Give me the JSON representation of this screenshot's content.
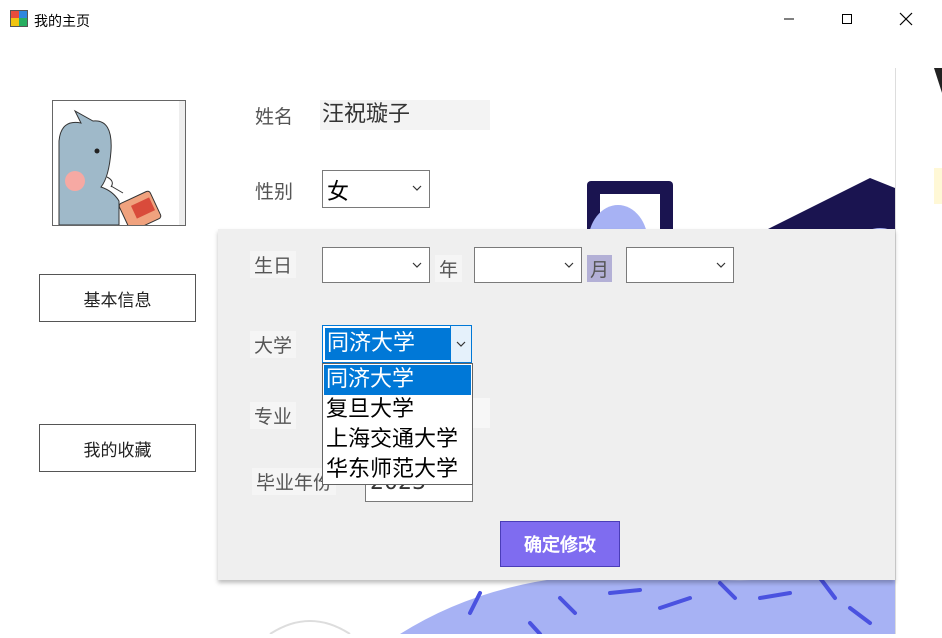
{
  "window": {
    "title": "我的主页"
  },
  "sidebar": {
    "basic_info_label": "基本信息",
    "favorites_label": "我的收藏"
  },
  "profile": {
    "name_label": "姓名",
    "name_value": "汪祝璇子",
    "gender_label": "性别",
    "gender_value": "女"
  },
  "form": {
    "birthday_label": "生日",
    "year_label": "年",
    "month_label": "月",
    "birth_year_value": "",
    "birth_month_value": "",
    "birth_day_value": "",
    "university_label": "大学",
    "university_value": "同济大学",
    "university_options": [
      "同济大学",
      "复旦大学",
      "上海交通大学",
      "华东师范大学"
    ],
    "major_label": "专业",
    "grad_year_label": "毕业年份",
    "grad_year_value": "2023",
    "confirm_label": "确定修改"
  },
  "colors": {
    "accent_button": "#7f6cf0",
    "selection_blue": "#0078d7",
    "decor_navy": "#1a1450",
    "decor_periwinkle": "#a7b2f4"
  }
}
